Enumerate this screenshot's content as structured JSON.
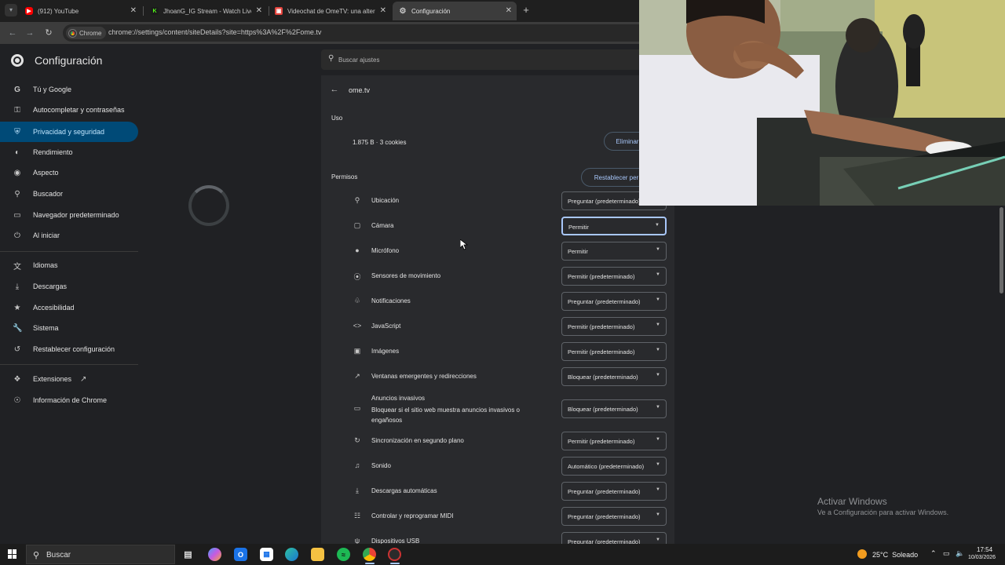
{
  "tabs": [
    {
      "title": "(912) YouTube",
      "favicon": "youtube-icon",
      "color": "#ff0000",
      "active": false
    },
    {
      "title": "JhoanG_IG Stream - Watch Live",
      "favicon": "kick-icon",
      "color": "#53fc18",
      "active": false
    },
    {
      "title": "Videochat de OmeTV: una altern",
      "favicon": "ometv-icon",
      "color": "#e5443d",
      "active": false
    },
    {
      "title": "Configuración",
      "favicon": "gear-icon",
      "color": "#c7c7c7",
      "active": true
    }
  ],
  "toolbar": {
    "chip_label": "Chrome",
    "url": "chrome://settings/content/siteDetails?site=https%3A%2F%2Fome.tv"
  },
  "header": {
    "title": "Configuración",
    "search_placeholder": "Buscar ajustes"
  },
  "sidebar": {
    "items": [
      {
        "label": "Tú y Google",
        "icon": "google-icon"
      },
      {
        "label": "Autocompletar y contraseñas",
        "icon": "key-icon"
      },
      {
        "label": "Privacidad y seguridad",
        "icon": "shield-icon",
        "selected": true
      },
      {
        "label": "Rendimiento",
        "icon": "speedometer-icon"
      },
      {
        "label": "Aspecto",
        "icon": "palette-icon"
      },
      {
        "label": "Buscador",
        "icon": "search-icon"
      },
      {
        "label": "Navegador predeterminado",
        "icon": "browser-icon"
      },
      {
        "label": "Al iniciar",
        "icon": "power-icon"
      },
      {
        "label": "Idiomas",
        "icon": "translate-icon"
      },
      {
        "label": "Descargas",
        "icon": "download-icon"
      },
      {
        "label": "Accesibilidad",
        "icon": "accessibility-icon"
      },
      {
        "label": "Sistema",
        "icon": "wrench-icon"
      },
      {
        "label": "Restablecer configuración",
        "icon": "reset-icon"
      },
      {
        "label": "Extensiones",
        "icon": "puzzle-icon"
      },
      {
        "label": "Información de Chrome",
        "icon": "chrome-icon"
      }
    ]
  },
  "site": {
    "name": "ome.tv",
    "usage_heading": "Uso",
    "usage_value": "1.875 B · 3 cookies",
    "delete_label": "Eliminar",
    "permissions_heading": "Permisos",
    "reset_label": "Restablecer per"
  },
  "permissions": [
    {
      "label": "Ubicación",
      "value": "Preguntar (predeterminado)",
      "icon": "location-icon"
    },
    {
      "label": "Cámara",
      "value": "Permitir",
      "icon": "camera-icon",
      "focused": true
    },
    {
      "label": "Micrófono",
      "value": "Permitir",
      "icon": "microphone-icon"
    },
    {
      "label": "Sensores de movimiento",
      "value": "Permitir (predeterminado)",
      "icon": "sensors-icon"
    },
    {
      "label": "Notificaciones",
      "value": "Preguntar (predeterminado)",
      "icon": "bell-icon"
    },
    {
      "label": "JavaScript",
      "value": "Permitir (predeterminado)",
      "icon": "code-icon"
    },
    {
      "label": "Imágenes",
      "value": "Permitir (predeterminado)",
      "icon": "image-icon"
    },
    {
      "label": "Ventanas emergentes y redirecciones",
      "value": "Bloquear (predeterminado)",
      "icon": "popup-icon"
    },
    {
      "label": "Anuncios invasivos",
      "sublabel": "Bloquear si el sitio web muestra anuncios invasivos o engañosos",
      "value": "Bloquear (predeterminado)",
      "icon": "ads-icon"
    },
    {
      "label": "Sincronización en segundo plano",
      "value": "Permitir (predeterminado)",
      "icon": "sync-icon"
    },
    {
      "label": "Sonido",
      "value": "Automático (predeterminado)",
      "icon": "speaker-icon"
    },
    {
      "label": "Descargas automáticas",
      "value": "Preguntar (predeterminado)",
      "icon": "download-icon"
    },
    {
      "label": "Controlar y reprogramar MIDI",
      "value": "Preguntar (predeterminado)",
      "icon": "midi-icon"
    },
    {
      "label": "Dispositivos USB",
      "value": "Preguntar (predeterminado)",
      "icon": "usb-icon"
    }
  ],
  "watermark": {
    "line1": "Activar Windows",
    "line2": "Ve a Configuración para activar Windows."
  },
  "taskbar": {
    "search_label": "Buscar",
    "weather": "25°C  Soleado",
    "time": "17:54",
    "date": "10/03/2026"
  }
}
